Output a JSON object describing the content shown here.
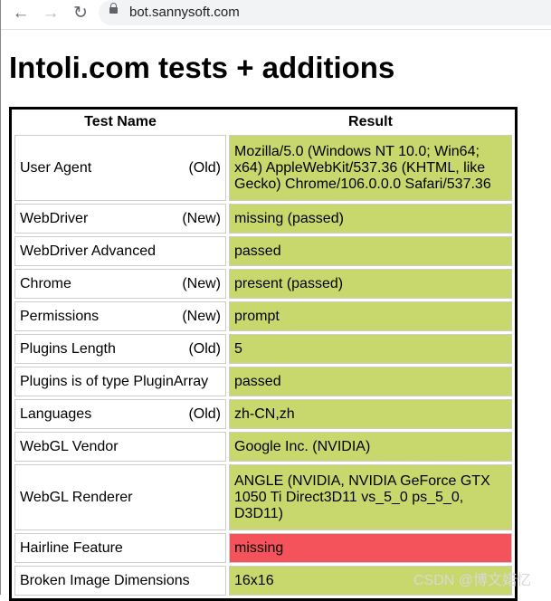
{
  "browser": {
    "url": "bot.sannysoft.com",
    "back_icon": "arrow-left-icon",
    "forward_icon": "arrow-right-icon",
    "reload_icon": "reload-icon",
    "lock_icon": "lock-icon"
  },
  "page": {
    "title": "Intoli.com tests + additions"
  },
  "table": {
    "headers": [
      "Test Name",
      "Result"
    ],
    "colors": {
      "pass": "#c9d86d",
      "fail": "#f5535b"
    },
    "rows": [
      {
        "name": "User Agent",
        "tag": "(Old)",
        "result": "Mozilla/5.0 (Windows NT 10.0; Win64; x64) AppleWebKit/537.36 (KHTML, like Gecko) Chrome/106.0.0.0 Safari/537.36",
        "status": "pass"
      },
      {
        "name": "WebDriver",
        "tag": "(New)",
        "result": "missing (passed)",
        "status": "pass"
      },
      {
        "name": "WebDriver Advanced",
        "tag": "",
        "result": "passed",
        "status": "pass"
      },
      {
        "name": "Chrome",
        "tag": "(New)",
        "result": "present (passed)",
        "status": "pass"
      },
      {
        "name": "Permissions",
        "tag": "(New)",
        "result": "prompt",
        "status": "pass"
      },
      {
        "name": "Plugins Length",
        "tag": "(Old)",
        "result": "5",
        "status": "pass"
      },
      {
        "name": "Plugins is of type PluginArray",
        "tag": "",
        "result": "passed",
        "status": "pass"
      },
      {
        "name": "Languages",
        "tag": "(Old)",
        "result": "zh-CN,zh",
        "status": "pass"
      },
      {
        "name": "WebGL Vendor",
        "tag": "",
        "result": "Google Inc. (NVIDIA)",
        "status": "pass"
      },
      {
        "name": "WebGL Renderer",
        "tag": "",
        "result": "ANGLE (NVIDIA, NVIDIA GeForce GTX 1050 Ti Direct3D11 vs_5_0 ps_5_0, D3D11)",
        "status": "pass"
      },
      {
        "name": "Hairline Feature",
        "tag": "",
        "result": "missing",
        "status": "fail"
      },
      {
        "name": "Broken Image Dimensions",
        "tag": "",
        "result": "16x16",
        "status": "pass"
      }
    ]
  },
  "watermark": "CSDN @博文婼忆"
}
